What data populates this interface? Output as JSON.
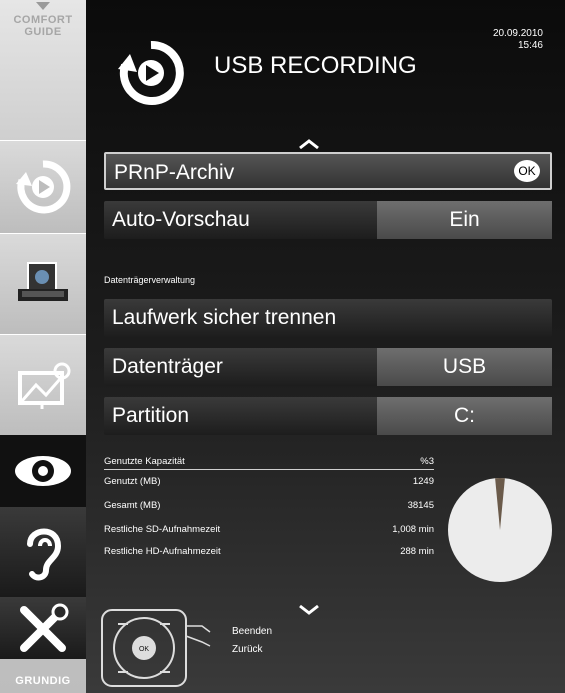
{
  "sidebar": {
    "comfort_guide": "COMFORT\nGUIDE",
    "items": [
      {
        "icon": "usb-recording-icon"
      },
      {
        "icon": "photo-frame-icon"
      },
      {
        "icon": "monitor-connect-icon"
      },
      {
        "icon": "eye-icon"
      },
      {
        "icon": "ear-icon"
      },
      {
        "icon": "tools-icon"
      }
    ],
    "brand": "GRUNDIG"
  },
  "header": {
    "date": "20.09.2010",
    "time": "15:46",
    "title": "USB RECORDING"
  },
  "menu": {
    "items": [
      {
        "label": "PRnP-Archiv",
        "action": "OK"
      },
      {
        "label": "Auto-Vorschau",
        "value": "Ein"
      }
    ],
    "section_label": "Datenträgerverwaltung",
    "drive_items": [
      {
        "label": "Laufwerk sicher trennen"
      },
      {
        "label": "Datenträger",
        "value": "USB"
      },
      {
        "label": "Partition",
        "value": "C:"
      }
    ]
  },
  "stats": [
    {
      "label": "Genutzte Kapazität",
      "value": "%3"
    },
    {
      "label": "Genutzt (MB)",
      "value": "1249"
    },
    {
      "label": "Gesamt (MB)",
      "value": "38145"
    },
    {
      "label": "Restliche SD-Aufnahmezeit",
      "value": "1,008 min"
    },
    {
      "label": "Restliche HD-Aufnahmezeit",
      "value": "288 min"
    }
  ],
  "usage_fraction": 0.03,
  "remote": {
    "ok_label": "OK",
    "exit": "Beenden",
    "back": "Zurück"
  }
}
